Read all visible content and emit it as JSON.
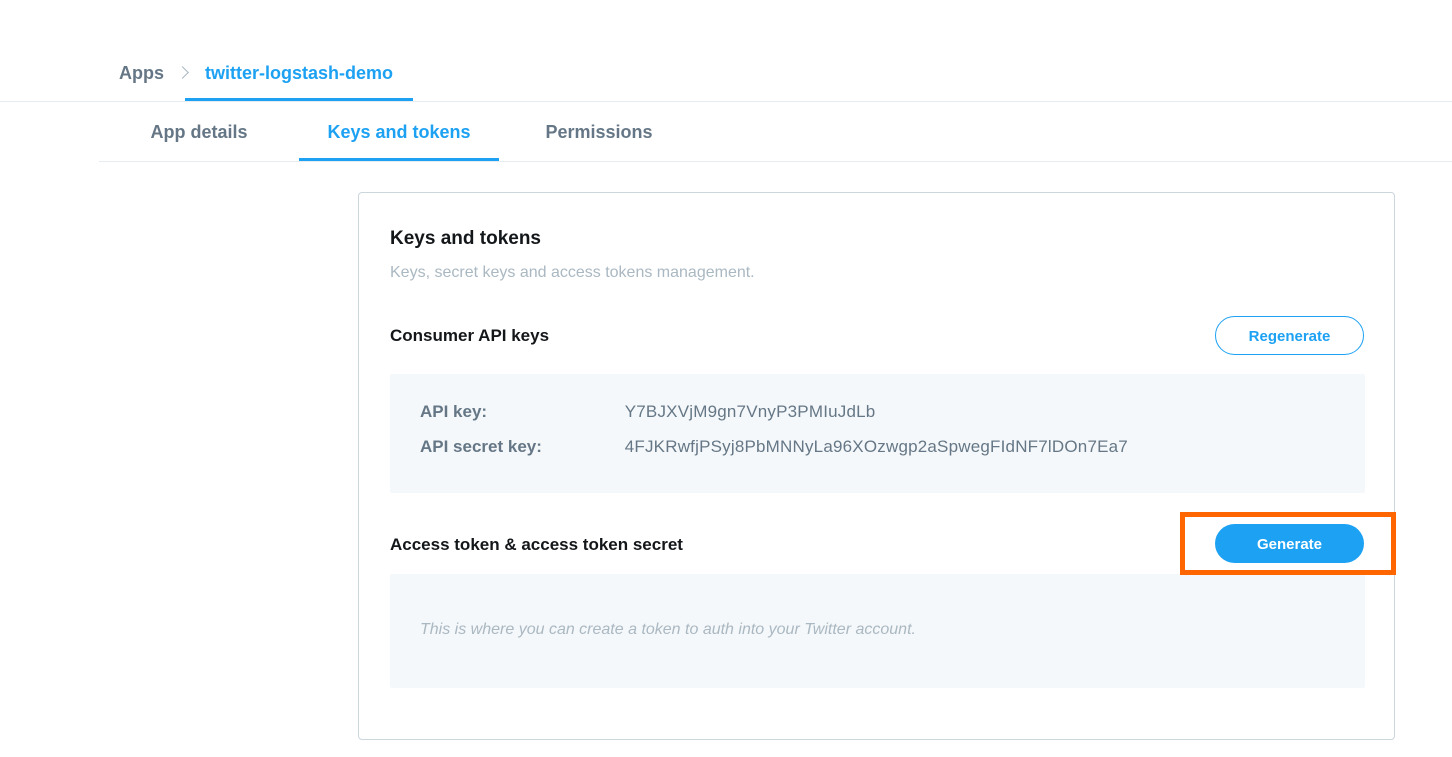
{
  "breadcrumb": {
    "root": "Apps",
    "current": "twitter-logstash-demo"
  },
  "tabs": [
    {
      "label": "App details",
      "active": false
    },
    {
      "label": "Keys and tokens",
      "active": true
    },
    {
      "label": "Permissions",
      "active": false
    }
  ],
  "card": {
    "title": "Keys and tokens",
    "subtitle": "Keys, secret keys and access tokens management.",
    "consumer": {
      "title": "Consumer API keys",
      "button_label": "Regenerate",
      "keys": [
        {
          "label": "API key:",
          "value": "Y7BJXVjM9gn7VnyP3PMIuJdLb"
        },
        {
          "label": "API secret key:",
          "value": "4FJKRwfjPSyj8PbMNNyLa96XOzwgp2aSpwegFIdNF7lDOn7Ea7"
        }
      ]
    },
    "access": {
      "title": "Access token & access token secret",
      "button_label": "Generate",
      "placeholder": "This is where you can create a token to auth into your Twitter account."
    }
  },
  "colors": {
    "accent": "#1da1f2",
    "highlight": "#ff6600",
    "muted": "#657786"
  },
  "icons": {
    "breadcrumb_separator": "chevron-right-icon"
  }
}
